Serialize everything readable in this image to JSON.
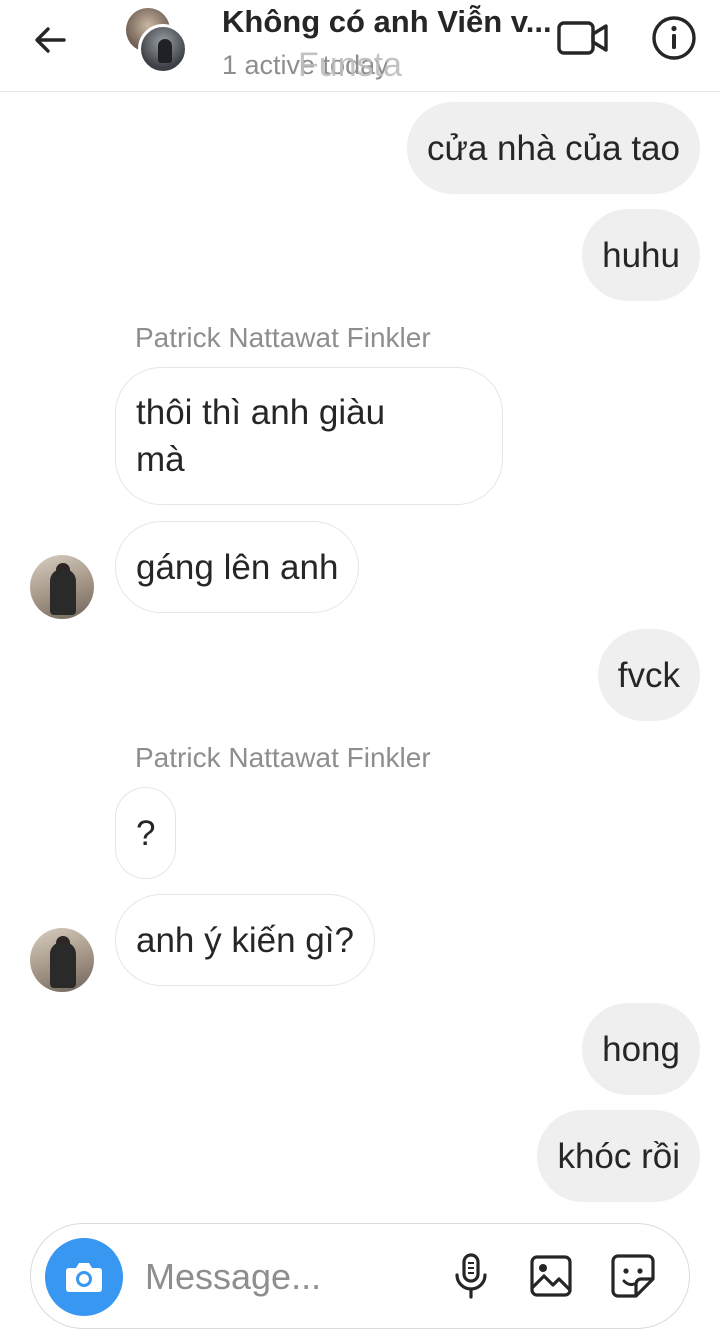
{
  "header": {
    "title": "Không có anh Viễn v...",
    "status": "1 active today",
    "watermark": "Funsta",
    "icons": {
      "back": "back-arrow-icon",
      "video": "video-call-icon",
      "info": "info-icon"
    }
  },
  "messages": [
    {
      "direction": "outgoing",
      "text": "cửa nhà của tao"
    },
    {
      "direction": "outgoing",
      "text": "huhu"
    },
    {
      "direction": "incoming",
      "sender": "Patrick Nattawat Finkler",
      "text": "thôi thì anh giàu\nmà"
    },
    {
      "direction": "incoming",
      "text": "gáng lên anh",
      "avatar": true
    },
    {
      "direction": "outgoing",
      "text": "fvck"
    },
    {
      "direction": "incoming",
      "sender": "Patrick Nattawat Finkler",
      "text": "?"
    },
    {
      "direction": "incoming",
      "text": "anh ý kiến gì?",
      "avatar": true
    },
    {
      "direction": "outgoing",
      "text": "hong"
    },
    {
      "direction": "outgoing",
      "text": "khóc rồi"
    }
  ],
  "composer": {
    "placeholder": "Message...",
    "icons": {
      "camera": "camera-icon",
      "mic": "microphone-icon",
      "gallery": "image-gallery-icon",
      "sticker": "sticker-icon"
    },
    "accent": "#3897f0"
  }
}
